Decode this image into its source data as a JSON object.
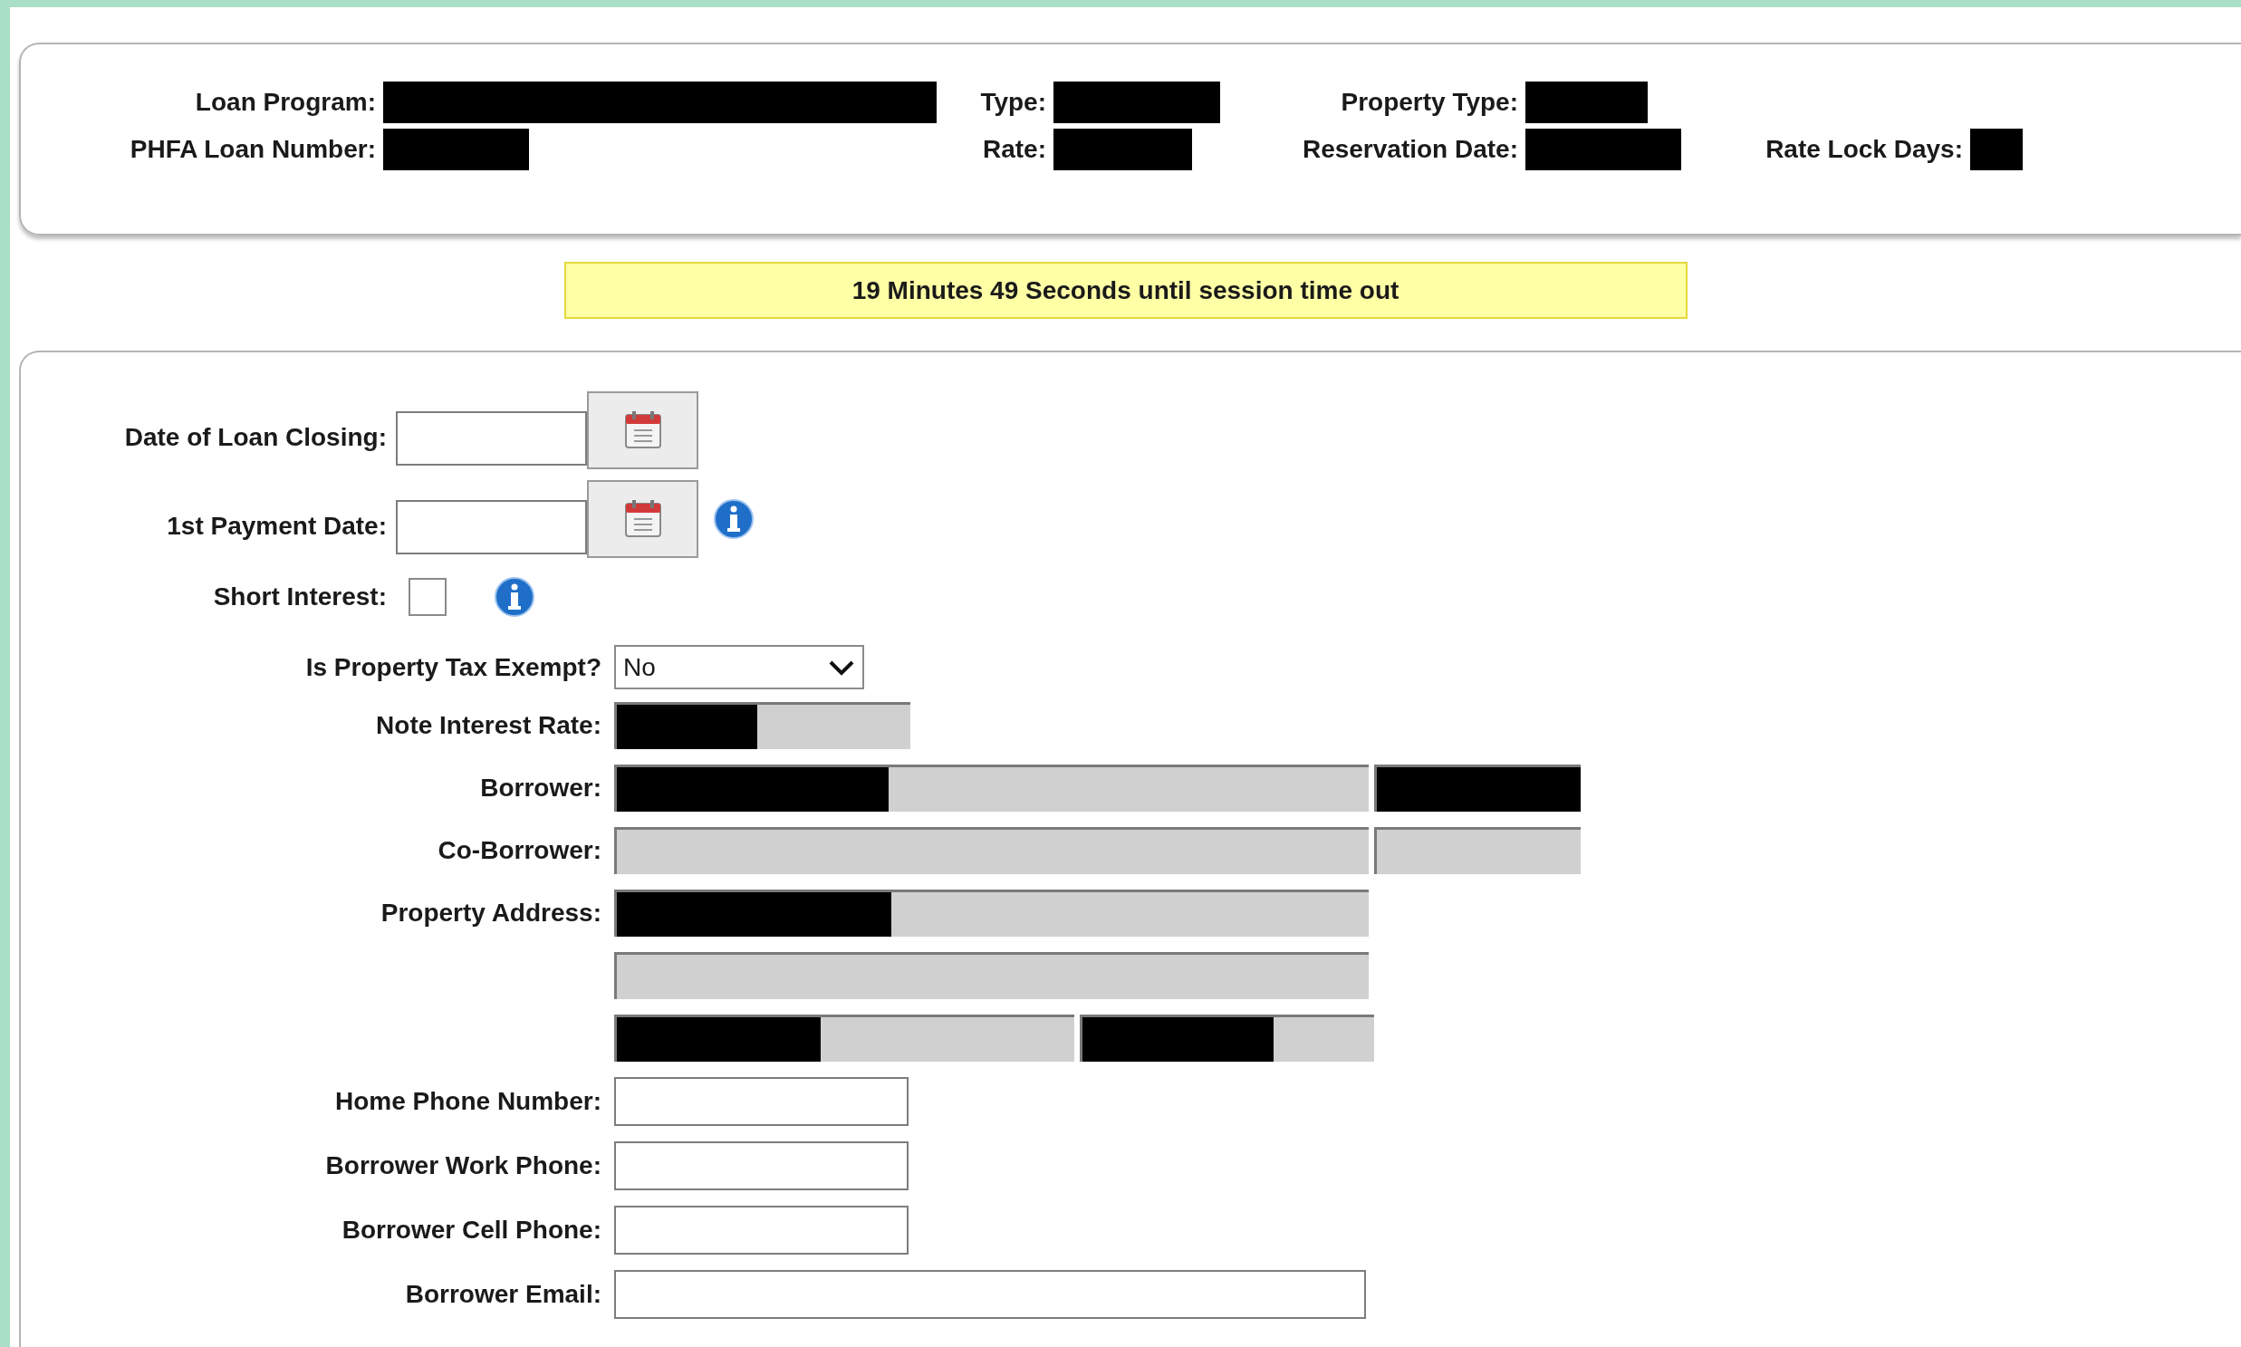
{
  "loan_summary": {
    "rows": [
      [
        {
          "label": "Loan Program:",
          "redacted": true
        },
        {
          "label": "Type:",
          "redacted": true
        },
        {
          "label": "Property Type:",
          "redacted": true
        }
      ],
      [
        {
          "label": "PHFA Loan Number:",
          "redacted": true
        },
        {
          "label": "Rate:",
          "redacted": true
        },
        {
          "label": "Reservation Date:",
          "redacted": true
        },
        {
          "label": "Rate Lock Days:",
          "redacted": true
        }
      ]
    ]
  },
  "session_banner": {
    "text": "19 Minutes 49 Seconds until session time out"
  },
  "closing_form": {
    "date_rows": [
      {
        "label": "Date of Loan Closing:",
        "info": false
      },
      {
        "label": "1st Payment Date:",
        "info": true
      }
    ],
    "short_interest": {
      "label": "Short Interest:",
      "checked": false,
      "info": true
    },
    "tax_exempt": {
      "label": "Is Property Tax Exempt?",
      "value": "No"
    },
    "rows": [
      {
        "label": "Note Interest Rate:",
        "fields": [
          {
            "kind": "readonly",
            "redacted": true
          }
        ]
      },
      {
        "label": "Borrower:",
        "fields": [
          {
            "kind": "readonly",
            "redacted": true
          },
          {
            "kind": "readonly",
            "redacted": true
          }
        ]
      },
      {
        "label": "Co-Borrower:",
        "fields": [
          {
            "kind": "readonly",
            "redacted": false
          },
          {
            "kind": "readonly",
            "redacted": false
          }
        ]
      },
      {
        "label": "Property Address:",
        "fields": [
          {
            "kind": "readonly",
            "redacted": true
          }
        ]
      },
      {
        "fields": [
          {
            "kind": "readonly",
            "redacted": false
          }
        ]
      },
      {
        "fields": [
          {
            "kind": "readonly",
            "redacted": true
          },
          {
            "kind": "readonly",
            "redacted": true
          }
        ]
      },
      {
        "label": "Home Phone Number:",
        "fields": [
          {
            "kind": "input"
          }
        ]
      },
      {
        "label": "Borrower Work Phone:",
        "fields": [
          {
            "kind": "input"
          }
        ]
      },
      {
        "label": "Borrower Cell Phone:",
        "fields": [
          {
            "kind": "input"
          }
        ]
      },
      {
        "label": "Borrower Email:",
        "fields": [
          {
            "kind": "input"
          }
        ]
      }
    ]
  }
}
